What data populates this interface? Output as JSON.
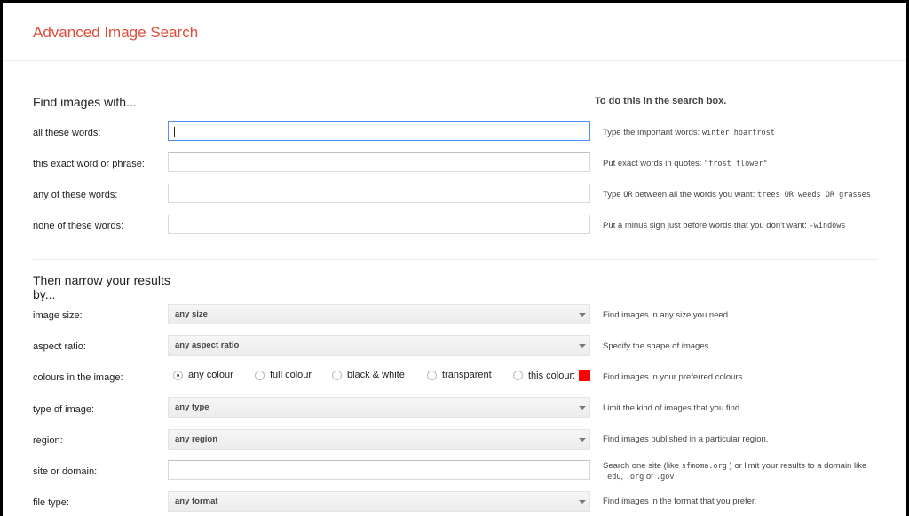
{
  "header": {
    "title": "Advanced Image Search"
  },
  "find_section": {
    "heading": "Find images with...",
    "tips_heading": "To do this in the search box.",
    "rows": [
      {
        "label": "all these words:",
        "value": "",
        "tip_text": "Type the important words:",
        "tip_example": "winter hoarfrost"
      },
      {
        "label": "this exact word or phrase:",
        "value": "",
        "tip_text": "Put exact words in quotes:",
        "tip_example": "\"frost flower\""
      },
      {
        "label": "any of these words:",
        "value": "",
        "tip_text": "Type",
        "tip_or": "OR",
        "tip_text2": "between all the words you want:",
        "tip_example": "trees OR weeds OR grasses"
      },
      {
        "label": "none of these words:",
        "value": "",
        "tip_text": "Put a minus sign just before words that you don't want:",
        "tip_example": "-windows"
      }
    ]
  },
  "narrow_section": {
    "heading_line1": "Then narrow your results",
    "heading_line2": "by...",
    "image_size": {
      "label": "image size:",
      "value": "any size",
      "tip": "Find images in any size you need."
    },
    "aspect_ratio": {
      "label": "aspect ratio:",
      "value": "any aspect ratio",
      "tip": "Specify the shape of images."
    },
    "colours": {
      "label": "colours in the image:",
      "options": [
        "any colour",
        "full colour",
        "black & white",
        "transparent",
        "this colour:"
      ],
      "selected": "any colour",
      "swatch_color": "#ff0000",
      "tip": "Find images in your preferred colours."
    },
    "type_of_image": {
      "label": "type of image:",
      "value": "any type",
      "tip": "Limit the kind of images that you find."
    },
    "region": {
      "label": "region:",
      "value": "any region",
      "tip": "Find images published in a particular region."
    },
    "site_or_domain": {
      "label": "site or domain:",
      "value": "",
      "tip_a": "Search one site (like",
      "tip_site": "sfmoma.org",
      "tip_b": ") or limit your results to a domain like",
      "tip_d1": ".edu",
      "tip_sep1": ",",
      "tip_d2": ".org",
      "tip_or": "or",
      "tip_d3": ".gov"
    },
    "file_type": {
      "label": "file type:",
      "value": "any format",
      "tip": "Find images in the format that you prefer."
    }
  },
  "colors": {
    "accent": "#dd4b39",
    "focus_border": "#4d90fe"
  }
}
